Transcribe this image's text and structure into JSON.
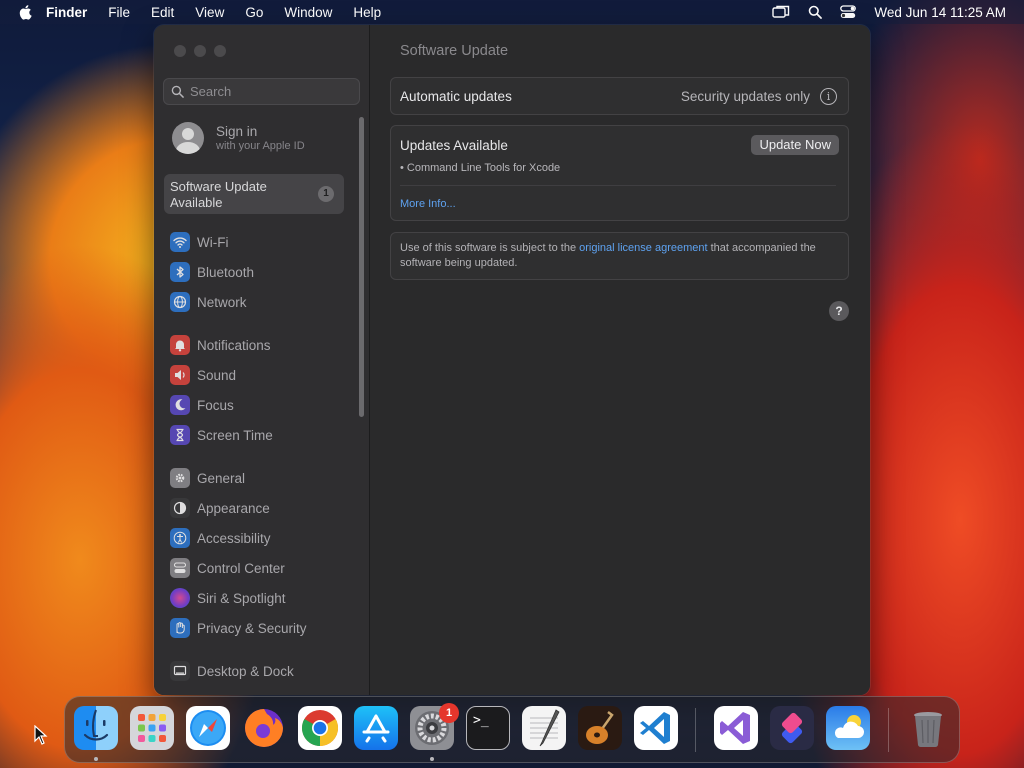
{
  "menubar": {
    "app_name": "Finder",
    "items": [
      "File",
      "Edit",
      "View",
      "Go",
      "Window",
      "Help"
    ],
    "clock": "Wed Jun 14  11:25 AM"
  },
  "window": {
    "search_placeholder": "Search",
    "signin": {
      "title": "Sign in",
      "subtitle": "with your Apple ID"
    },
    "selected_item": {
      "label_line1": "Software Update",
      "label_line2": "Available",
      "badge": "1"
    },
    "sidebar_items": [
      {
        "label": "Wi-Fi",
        "icon": "wifi-icon",
        "color": "#2d7ad6"
      },
      {
        "label": "Bluetooth",
        "icon": "bluetooth-icon",
        "color": "#2d7ad6"
      },
      {
        "label": "Network",
        "icon": "globe-icon",
        "color": "#2d7ad6"
      },
      {
        "label": "Notifications",
        "icon": "bell-icon",
        "color": "#e0463f"
      },
      {
        "label": "Sound",
        "icon": "speaker-icon",
        "color": "#e0463f"
      },
      {
        "label": "Focus",
        "icon": "moon-icon",
        "color": "#5d4cc9"
      },
      {
        "label": "Screen Time",
        "icon": "hourglass-icon",
        "color": "#5d4cc9"
      },
      {
        "label": "General",
        "icon": "gear-icon",
        "color": "#8e8d91"
      },
      {
        "label": "Appearance",
        "icon": "appearance-icon",
        "color": "#3a3a3c"
      },
      {
        "label": "Accessibility",
        "icon": "accessibility-icon",
        "color": "#2d7ad6"
      },
      {
        "label": "Control Center",
        "icon": "control-center-icon",
        "color": "#8e8d91"
      },
      {
        "label": "Siri & Spotlight",
        "icon": "siri-icon",
        "color": "#b84fd1"
      },
      {
        "label": "Privacy & Security",
        "icon": "hand-icon",
        "color": "#2d7ad6"
      },
      {
        "label": "Desktop & Dock",
        "icon": "desktop-icon",
        "color": "#3a3a3c"
      }
    ],
    "main": {
      "title": "Software Update",
      "automatic_updates": {
        "label": "Automatic updates",
        "value": "Security updates only",
        "info": "i"
      },
      "updates": {
        "title": "Updates Available",
        "button": "Update Now",
        "item": "• Command Line Tools for Xcode",
        "more_info": "More Info..."
      },
      "license": {
        "before": "Use of this software is subject to the ",
        "link": "original license agreement",
        "after": " that accompanied the software being updated."
      },
      "help": "?"
    }
  },
  "dock": {
    "apps": [
      {
        "name": "Finder",
        "icon": "finder-icon"
      },
      {
        "name": "Launchpad",
        "icon": "launchpad-icon"
      },
      {
        "name": "Safari",
        "icon": "safari-icon"
      },
      {
        "name": "Firefox",
        "icon": "firefox-icon"
      },
      {
        "name": "Chrome",
        "icon": "chrome-icon"
      },
      {
        "name": "App Store",
        "icon": "app-store-icon"
      },
      {
        "name": "System Settings",
        "icon": "system-settings-icon"
      },
      {
        "name": "Terminal",
        "icon": "terminal-icon"
      },
      {
        "name": "TextEdit",
        "icon": "textedit-icon"
      },
      {
        "name": "GarageBand",
        "icon": "garageband-icon"
      },
      {
        "name": "Visual Studio Code",
        "icon": "vscode-icon"
      },
      {
        "name": "Visual Studio",
        "icon": "visual-studio-icon"
      },
      {
        "name": "Shortcuts",
        "icon": "shortcuts-icon"
      },
      {
        "name": "Weather",
        "icon": "weather-icon"
      },
      {
        "name": "Trash",
        "icon": "trash-icon"
      }
    ],
    "settings_badge": "1",
    "terminal_prompt": ">_"
  }
}
